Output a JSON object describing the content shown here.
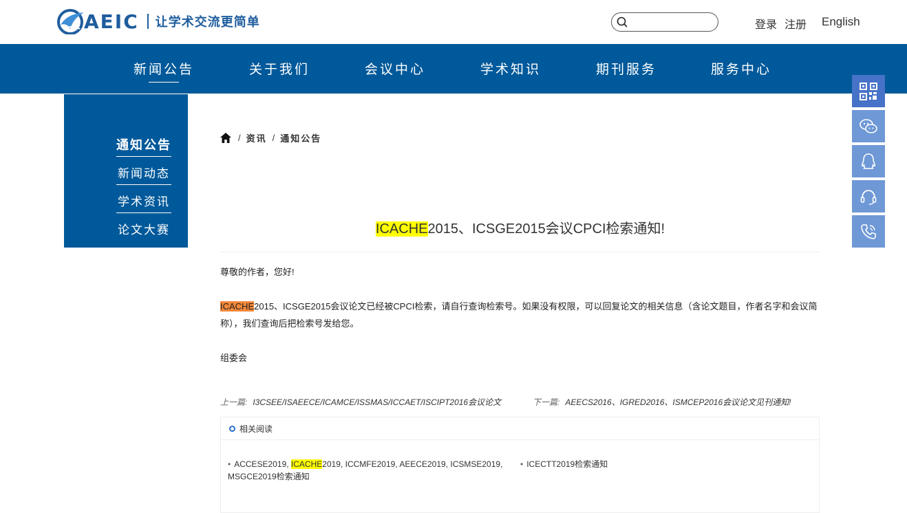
{
  "header": {
    "logo_text": "AEIC",
    "slogan": "让学术交流更简单",
    "search": {
      "placeholder": "",
      "value": ""
    },
    "login_label": "登录",
    "register_label": "注册",
    "english_label": "English"
  },
  "nav": {
    "items": [
      {
        "label": "新闻公告"
      },
      {
        "label": "关于我们"
      },
      {
        "label": "会议中心"
      },
      {
        "label": "学术知识"
      },
      {
        "label": "期刊服务"
      },
      {
        "label": "服务中心"
      }
    ],
    "active": "新闻公告"
  },
  "sidebar": {
    "items": [
      {
        "label": "通知公告"
      },
      {
        "label": "新闻动态"
      },
      {
        "label": "学术资讯"
      },
      {
        "label": "论文大赛"
      }
    ],
    "active": "通知公告"
  },
  "breadcrumb": {
    "items": [
      {
        "label": "资讯"
      },
      {
        "label": "通知公告"
      }
    ],
    "separator": "/"
  },
  "article": {
    "title_highlight": "ICACHE",
    "title_rest": "2015、ICSGE2015会议CPCI检索通知!",
    "greeting": "尊敬的作者，您好!",
    "body_highlight": "ICACHE",
    "body_rest": "2015、ICSGE2015会议论文已经被CPCI检索，请自行查询检索号。如果没有权限，可以回复论文的相关信息（含论文题目，作者名字和会议简称），我们查询后把检索号发给您。",
    "signature": "组委会"
  },
  "pagination": {
    "prev_label": "上一篇:",
    "prev_title": "I3CSEE/ISAEECE/ICAMCE/ISSMAS/ICCAET/ISCIPT2016会议论文",
    "next_label": "下一篇:",
    "next_title": "AEECS2016、IGRED2016、ISMCEP2016会议论文见刊通知!"
  },
  "related": {
    "heading": "相关阅读",
    "items": [
      {
        "before": "ACCESE2019, ",
        "highlight": "ICACHE",
        "after": "2019, ICCMFE2019, AEECE2019, ICSMSE2019, MSGCE2019检索通知"
      },
      {
        "before": "ICECTT2019检索通知",
        "highlight": "",
        "after": ""
      }
    ]
  },
  "float_bar": {
    "buttons": [
      "qr-code-icon",
      "wechat-icon",
      "qq-icon",
      "headset-icon",
      "phone-icon"
    ]
  },
  "colors": {
    "brand_blue": "#00599a",
    "float_blue": "#6f98d6",
    "highlight_yellow": "#ffff00",
    "highlight_orange": "#f5883a"
  }
}
